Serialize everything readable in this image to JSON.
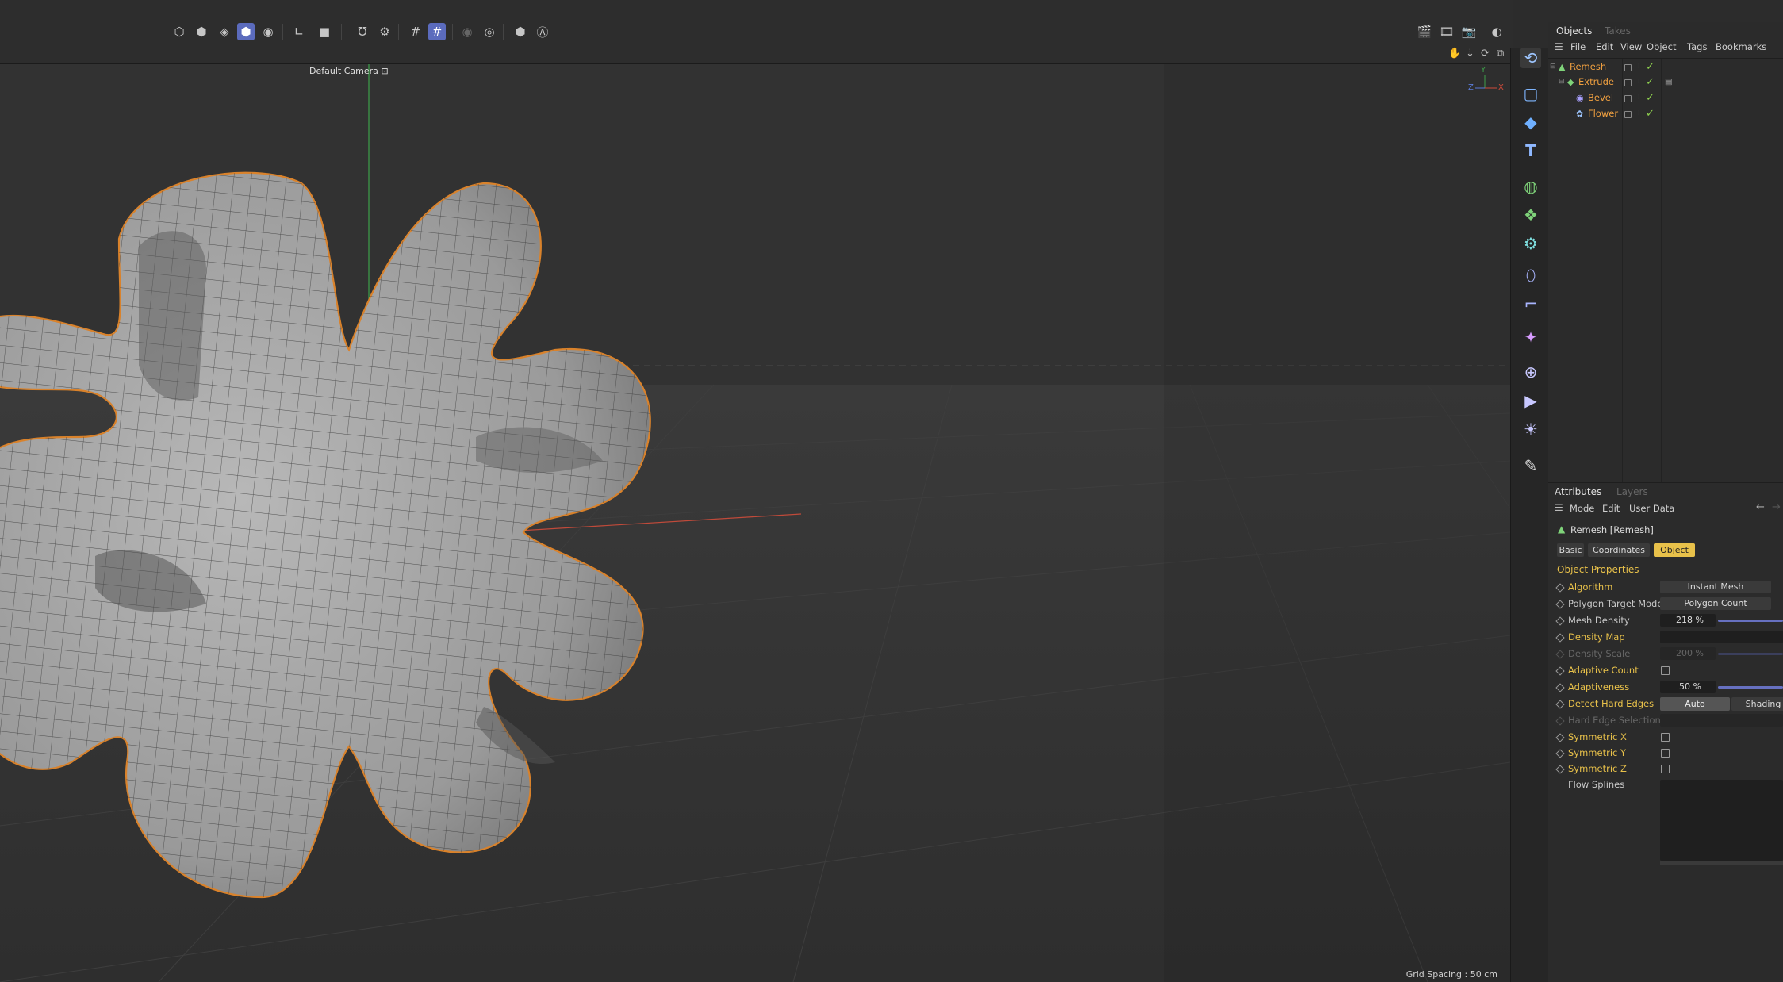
{
  "toolbar": {
    "icons": [
      "points-mode-icon",
      "edges-mode-icon",
      "polygons-mode-icon",
      "model-mode-icon",
      "texture-mode-icon",
      "axis-icon",
      "solo-icon",
      "magnet-icon",
      "snap-settings-icon",
      "grid-icon",
      "workplane-snap-icon",
      "render-region-icon",
      "render-settings-icon",
      "object-mode-icon",
      "auto-icon"
    ],
    "right_icons": [
      "clapper-icon",
      "clapper-play-icon",
      "picture-viewer-icon",
      "interactive-render-icon"
    ],
    "nav_icons": [
      "hand-move-icon",
      "zoom-arrow-icon",
      "rotate-icon",
      "maximize-icon"
    ]
  },
  "viewport": {
    "camera_label": "Default Camera",
    "grid_spacing": "Grid Spacing : 50 cm",
    "axis": {
      "y": "Y",
      "z": "Z",
      "x": "X"
    },
    "colors": {
      "selection_outline": "#d9822b",
      "mesh_fill": "#a3a3a3",
      "x_axis": "#c04a3a",
      "y_axis": "#3da04a"
    }
  },
  "palette": [
    "live-selection-icon",
    "rectangle-icon",
    "cube-icon",
    "text-icon",
    "subdivision-icon",
    "cloner-icon",
    "gear-effector-icon",
    "deformer-icon",
    "scene-icon",
    "spline-icon",
    "environment-icon",
    "camera-icon",
    "light-icon",
    "tag-icon"
  ],
  "objects": {
    "tabs": [
      "Objects",
      "Takes"
    ],
    "menu": [
      "File",
      "Edit",
      "View",
      "Object",
      "Tags",
      "Bookmarks"
    ],
    "rows": [
      {
        "name": "Remesh",
        "indent": 0,
        "color": "#f0a040",
        "icon": "remesh-icon"
      },
      {
        "name": "Extrude",
        "indent": 1,
        "color": "#f0a040",
        "icon": "extrude-icon"
      },
      {
        "name": "Bevel",
        "indent": 2,
        "color": "#f0a040",
        "icon": "bevel-icon"
      },
      {
        "name": "Flower",
        "indent": 2,
        "color": "#f0a040",
        "icon": "flower-icon"
      }
    ]
  },
  "attributes": {
    "tabs": [
      "Attributes",
      "Layers"
    ],
    "menu": [
      "Mode",
      "Edit",
      "User Data"
    ],
    "object_title": "Remesh [Remesh]",
    "section_tabs": [
      "Basic",
      "Coordinates",
      "Object"
    ],
    "active_section": "Object",
    "section_title": "Object Properties",
    "rows": {
      "algorithm": {
        "label": "Algorithm",
        "value": "Instant Mesh"
      },
      "polygon_target_mode": {
        "label": "Polygon Target Mode",
        "value": "Polygon Count"
      },
      "mesh_density": {
        "label": "Mesh Density",
        "value": "218 %"
      },
      "density_map": {
        "label": "Density Map",
        "value": ""
      },
      "density_scale": {
        "label": "Density Scale",
        "value": "200 %"
      },
      "adaptive_count": {
        "label": "Adaptive Count"
      },
      "adaptiveness": {
        "label": "Adaptiveness",
        "value": "50 %"
      },
      "detect_hard_edges": {
        "label": "Detect Hard Edges",
        "options": [
          "Auto",
          "Shading"
        ],
        "selected": "Auto"
      },
      "hard_edge_selection": {
        "label": "Hard Edge Selection"
      },
      "symmetric_x": {
        "label": "Symmetric X"
      },
      "symmetric_y": {
        "label": "Symmetric Y"
      },
      "symmetric_z": {
        "label": "Symmetric Z"
      },
      "flow_splines": {
        "label": "Flow Splines"
      }
    }
  }
}
